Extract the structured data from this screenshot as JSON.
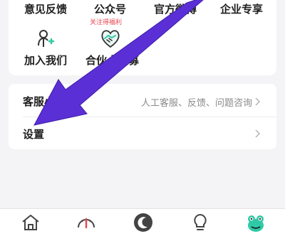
{
  "grid": {
    "row1": [
      {
        "label": "意见反馈"
      },
      {
        "label": "公众号",
        "sub": "关注得福利"
      },
      {
        "label": "官方微博"
      },
      {
        "label": "企业专享"
      }
    ],
    "row2": [
      {
        "label": "加入我们"
      },
      {
        "label": "合伙人招募"
      }
    ]
  },
  "list": {
    "service": {
      "title": "客服小助手",
      "detail": "人工客服、反馈、问题咨询"
    },
    "settings": {
      "title": "设置"
    }
  },
  "tabs": [
    "home-icon",
    "gauge-icon",
    "moon-icon",
    "bulb-icon",
    "frog-avatar-icon"
  ],
  "colors": {
    "arrow": "#5b2fd6",
    "accent_red": "#e5454e",
    "mint": "#2fc9a6"
  }
}
